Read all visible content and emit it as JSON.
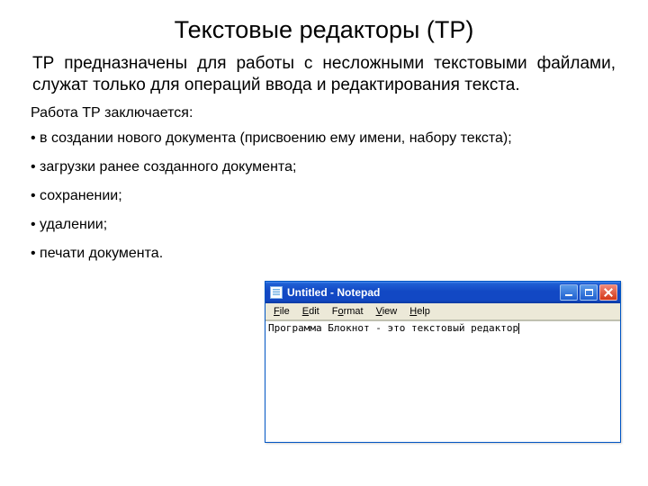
{
  "title": "Текстовые редакторы (ТР)",
  "intro": "ТР предназначены для работы с несложными текстовыми файлами, служат только для операций ввода и редактирования текста.",
  "subhead": "Работа ТР заключается:",
  "bullets": [
    "в создании нового документа (присвоению ему имени, набору текста);",
    "загрузки ранее созданного документа;",
    "сохранении;",
    "удалении;",
    "печати документа."
  ],
  "notepad": {
    "title": "Untitled - Notepad",
    "menu": {
      "file": "File",
      "edit": "Edit",
      "format": "Format",
      "view": "View",
      "help": "Help"
    },
    "content": "Программа Блокнот - это текстовый редактор"
  }
}
